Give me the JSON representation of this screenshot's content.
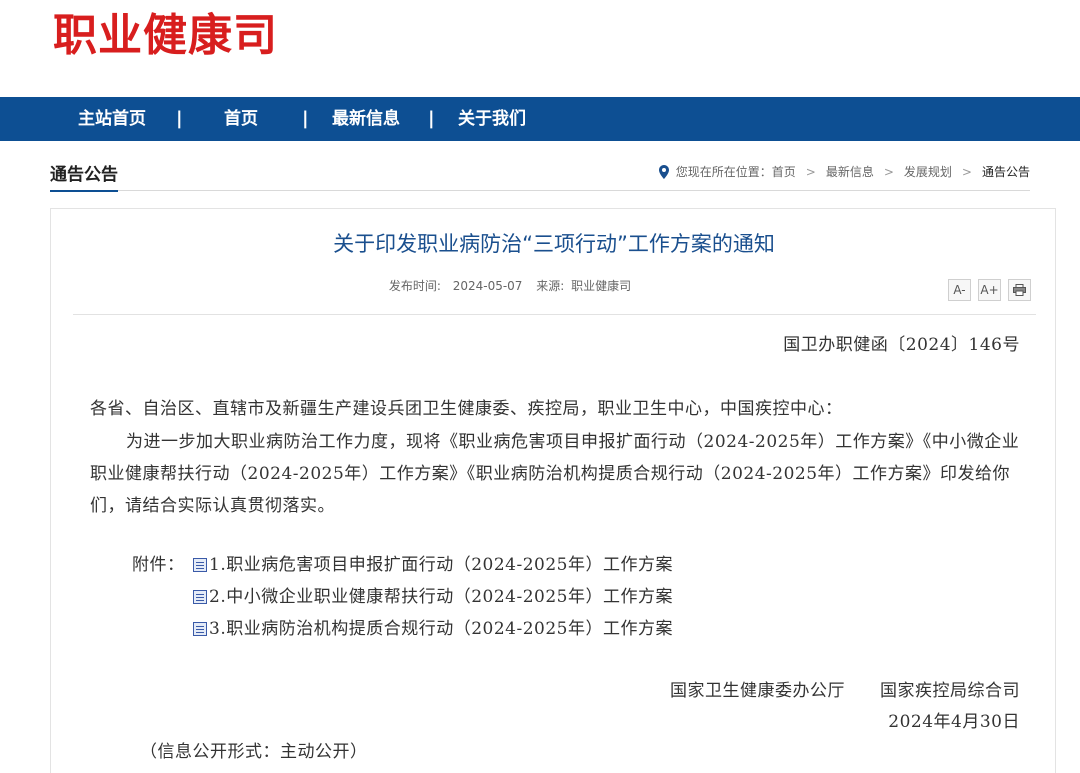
{
  "site": {
    "logo": "职业健康司"
  },
  "nav": {
    "items": [
      "主站首页",
      "首页",
      "最新信息",
      "关于我们"
    ],
    "separator": "|"
  },
  "section": {
    "title": "通告公告",
    "breadcrumb": {
      "prefix": "您现在所在位置：",
      "items": [
        "首页",
        "最新信息",
        "发展规划",
        "通告公告"
      ],
      "separator": ">"
    }
  },
  "article": {
    "title": "关于印发职业病防治“三项行动”工作方案的通知",
    "publish_label": "发布时间:",
    "publish_date": "2024-05-07",
    "source_label": "来源:",
    "source": "职业健康司",
    "tools": [
      "A-",
      "A+",
      "print-icon"
    ],
    "doc_number": "国卫办职健函〔2024〕146号",
    "salutation": "各省、自治区、直辖市及新疆生产建设兵团卫生健康委、疾控局，职业卫生中心，中国疾控中心：",
    "paragraph": "为进一步加大职业病防治工作力度，现将《职业病危害项目申报扩面行动（2024-2025年）工作方案》《中小微企业职业健康帮扶行动（2024-2025年）工作方案》《职业病防治机构提质合规行动（2024-2025年）工作方案》印发给你们，请结合实际认真贯彻落实。",
    "attachments_label": "附件：",
    "attachments": [
      "1.职业病危害项目申报扩面行动（2024-2025年）工作方案",
      "2.中小微企业职业健康帮扶行动（2024-2025年）工作方案",
      "3.职业病防治机构提质合规行动（2024-2025年）工作方案"
    ],
    "signatories": "国家卫生健康委办公厅　　国家疾控局综合司",
    "sign_date": "2024年4月30日",
    "disclosure": "（信息公开形式：主动公开）"
  },
  "colors": {
    "brand_red": "#d81e1e",
    "nav_blue": "#0d4f93",
    "title_blue": "#1a4f8e"
  }
}
